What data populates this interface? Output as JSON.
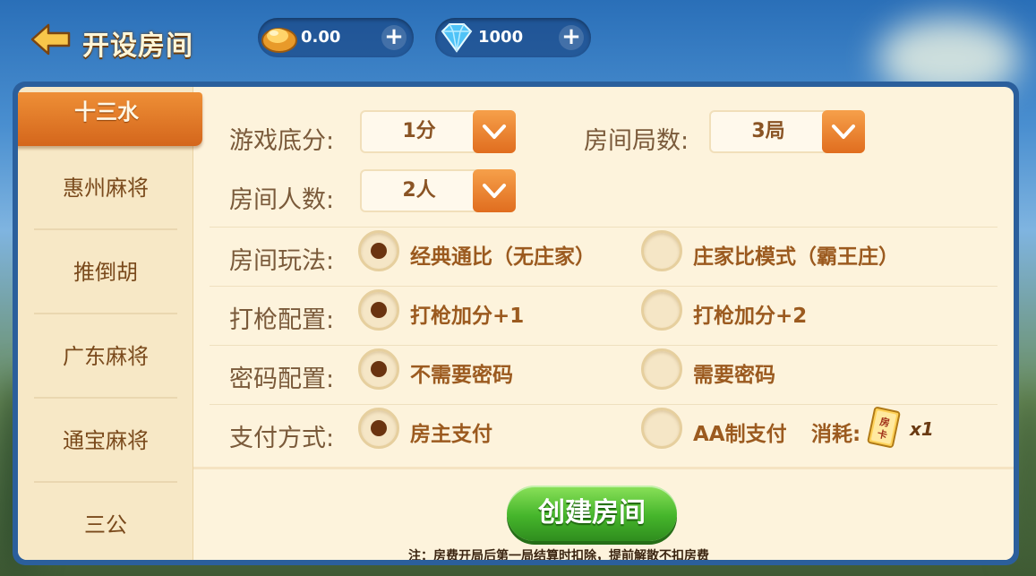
{
  "header": {
    "title": "开设房间",
    "gold": {
      "value": "0.00",
      "icon": "gold-ingot-icon"
    },
    "diamond": {
      "value": "1000",
      "icon": "diamond-icon"
    },
    "add_icon": "plus-icon",
    "back_icon": "back-arrow-icon"
  },
  "sidebar": {
    "items": [
      {
        "label": "十三水",
        "active": true
      },
      {
        "label": "惠州麻将",
        "active": false
      },
      {
        "label": "推倒胡",
        "active": false
      },
      {
        "label": "广东麻将",
        "active": false
      },
      {
        "label": "通宝麻将",
        "active": false
      },
      {
        "label": "三公",
        "active": false
      }
    ]
  },
  "settings": {
    "base_score": {
      "label": "游戏底分:",
      "value": "1分"
    },
    "rounds": {
      "label": "房间局数:",
      "value": "3局"
    },
    "players": {
      "label": "房间人数:",
      "value": "2人"
    },
    "mode": {
      "label": "房间玩法:",
      "options": [
        "经典通比（无庄家）",
        "庄家比模式（霸王庄）"
      ],
      "selected": 0
    },
    "gun": {
      "label": "打枪配置:",
      "options": [
        "打枪加分+1",
        "打枪加分+2"
      ],
      "selected": 0
    },
    "password": {
      "label": "密码配置:",
      "options": [
        "不需要密码",
        "需要密码"
      ],
      "selected": 0
    },
    "payment": {
      "label": "支付方式:",
      "options": [
        "房主支付",
        "AA制支付"
      ],
      "selected": 0
    },
    "cost": {
      "label": "消耗:",
      "card_text": "房卡",
      "multiplier": "x1"
    }
  },
  "footer": {
    "create_button": "创建房间",
    "note": "注：房费开局后第一局结算时扣除，提前解散不扣房费"
  },
  "colors": {
    "accent_orange": "#e06d1f",
    "button_green": "#45b52b",
    "panel_bg": "#fdf3dc",
    "frame_blue": "#2b5f9c"
  }
}
